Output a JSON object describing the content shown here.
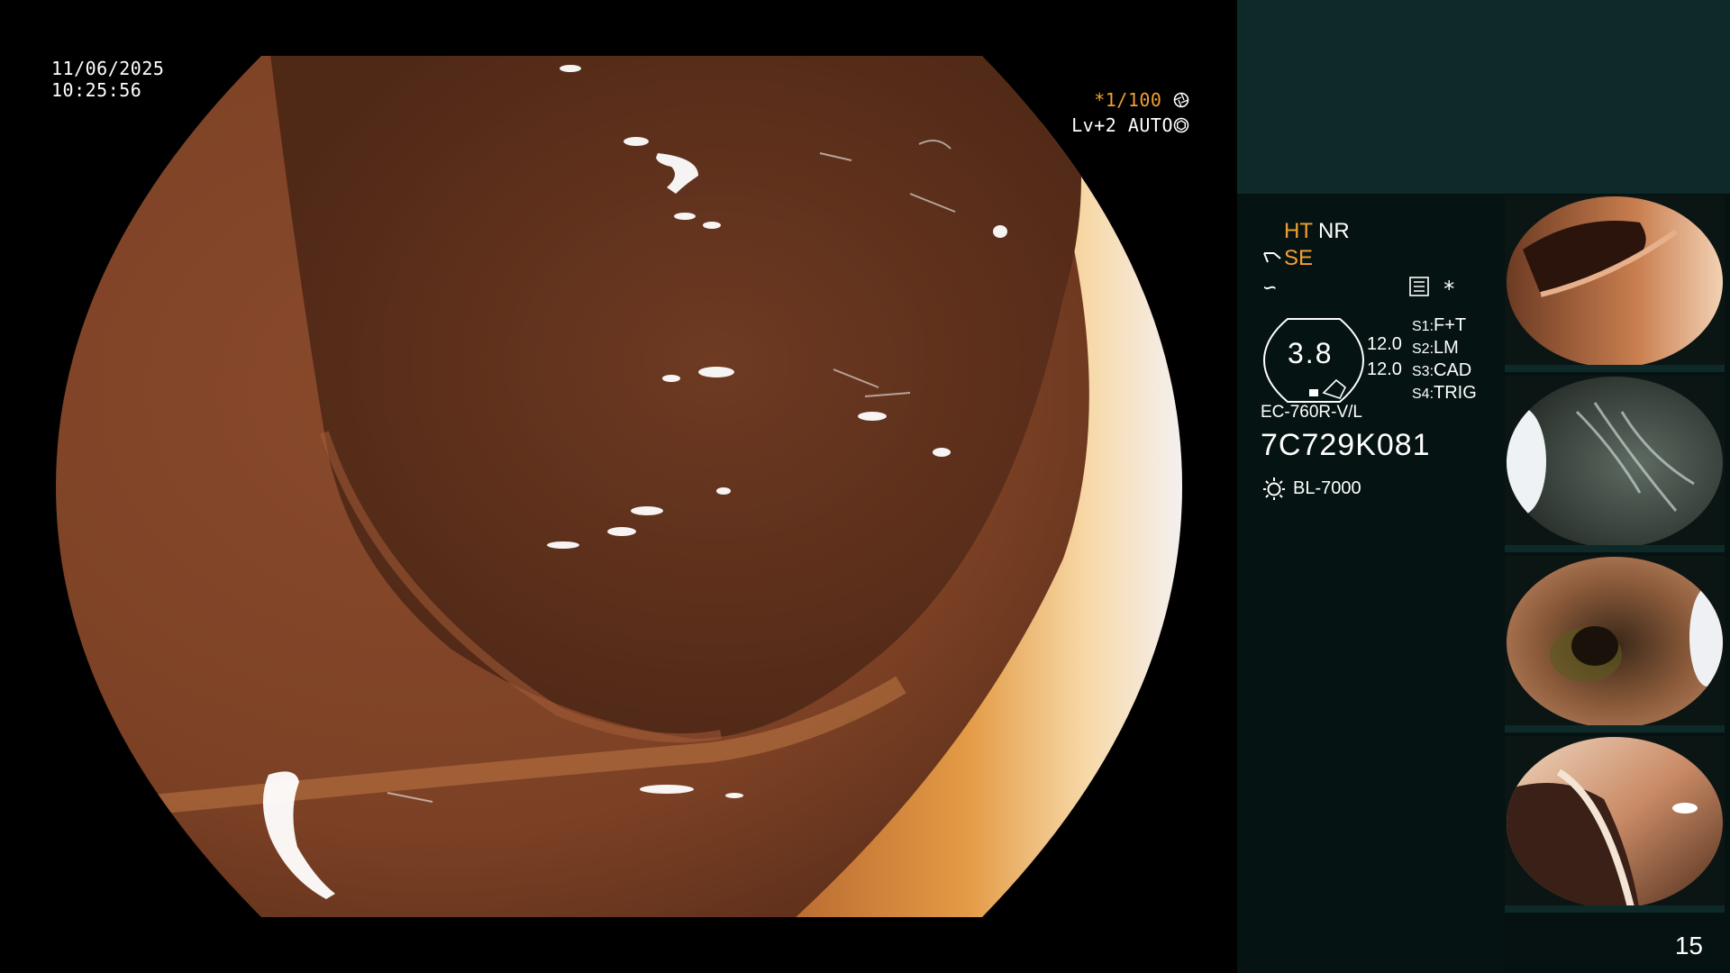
{
  "overlay": {
    "date": "11/06/2025",
    "time": "10:25:56",
    "shutter_prefix": "*1/100",
    "shutter_icon": "aperture-icon",
    "level": "Lv+2",
    "mode": "AUTO",
    "mode_icon": "iris-icon"
  },
  "settings": {
    "ht": "HT",
    "nr": "NR",
    "se": "SE",
    "se_icon": "wand-icon",
    "f_icon": "f-curve-icon",
    "menu_icon": "menu-list-icon",
    "star": "*",
    "gauge_value": "3.8",
    "gauge_secondary": [
      "12.0",
      "12.0"
    ],
    "switches": [
      {
        "key": "S1:",
        "value": "F+T"
      },
      {
        "key": "S2:",
        "value": "LM"
      },
      {
        "key": "S3:",
        "value": "CAD"
      },
      {
        "key": "S4:",
        "value": "TRIG"
      }
    ],
    "scope_model": "EC-760R-V/L",
    "scope_serial": "7C729K081",
    "light_icon": "sun-icon",
    "light_source": "BL-7000"
  },
  "thumbnails": [
    {
      "label": "thumbnail-1"
    },
    {
      "label": "thumbnail-2"
    },
    {
      "label": "thumbnail-3"
    },
    {
      "label": "thumbnail-4"
    }
  ],
  "page_number": "15",
  "colors": {
    "accent": "#f0a033",
    "panel_top": "#0d2a29",
    "panel_bg": "#061313"
  }
}
